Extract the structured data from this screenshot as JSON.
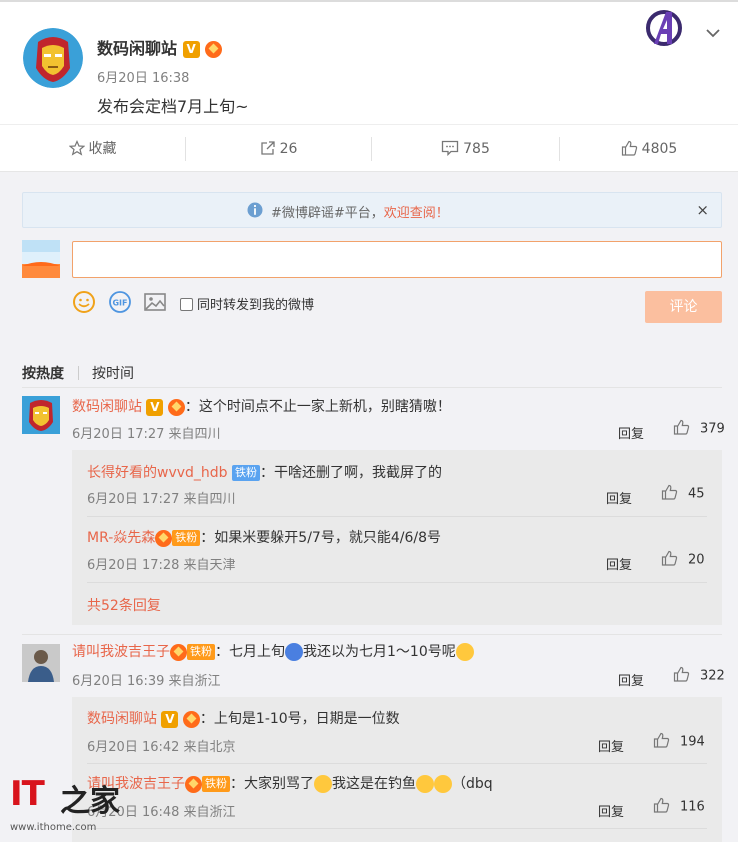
{
  "post": {
    "author": "数码闲聊站",
    "v_badge": "V",
    "time": "6月20日 16:38",
    "text": "发布会定档7月上旬~"
  },
  "actions": {
    "favorite": "收藏",
    "repost_count": "26",
    "comment_count": "785",
    "like_count": "4805"
  },
  "notice": {
    "prefix": "#微博辟谣#平台，",
    "highlight": "欢迎查阅！",
    "close": "×"
  },
  "composer": {
    "placeholder": "",
    "forward_label": "同时转发到我的微博",
    "submit_label": "评论"
  },
  "sort": {
    "hot": "按热度",
    "time": "按时间"
  },
  "comments": [
    {
      "author": "数码闲聊站",
      "v_badge": "V",
      "text": "：这个时间点不止一家上新机，别瞎猜嗷！",
      "meta": "6月20日 17:27 来自四川",
      "reply": "回复",
      "likes": "379",
      "replies": [
        {
          "author": "长得好看的wvvd_hdb",
          "badge": "铁粉",
          "text": "：干啥还删了啊，我截屏了的",
          "meta": "6月20日 17:27 来自四川",
          "reply": "回复",
          "likes": "45"
        },
        {
          "author": "MR-焱先森",
          "badge": "铁粉",
          "text": "：如果米要躲开5/7号，就只能4/6/8号",
          "meta": "6月20日 17:28 来自天津",
          "reply": "回复",
          "likes": "20"
        }
      ],
      "more": "共52条回复"
    },
    {
      "author": "请叫我波吉王子",
      "badge": "铁粉",
      "text_a": "：七月上旬",
      "text_b": "我还以为七月1～10号呢",
      "meta": "6月20日 16:39 来自浙江",
      "reply": "回复",
      "likes": "322",
      "replies": [
        {
          "author": "数码闲聊站",
          "v_badge": "V",
          "text": "：上旬是1-10号，日期是一位数",
          "meta": "6月20日 16:42 来自北京",
          "reply": "回复",
          "likes": "194"
        },
        {
          "author": "请叫我波吉王子",
          "badge": "铁粉",
          "text_a": "：大家别骂了",
          "text_b": "我这是在钓鱼",
          "text_c": "（dbq",
          "meta": "6月20日 16:48 来自浙江",
          "reply": "回复",
          "likes": "116"
        }
      ]
    }
  ],
  "watermark": {
    "brand": "IT",
    "brand_home": "之家",
    "url": "www.ithome.com"
  },
  "colors": {
    "accent": "#e8664a",
    "submit_disabled": "#fbbf9f",
    "input_border": "#f2a26b"
  }
}
